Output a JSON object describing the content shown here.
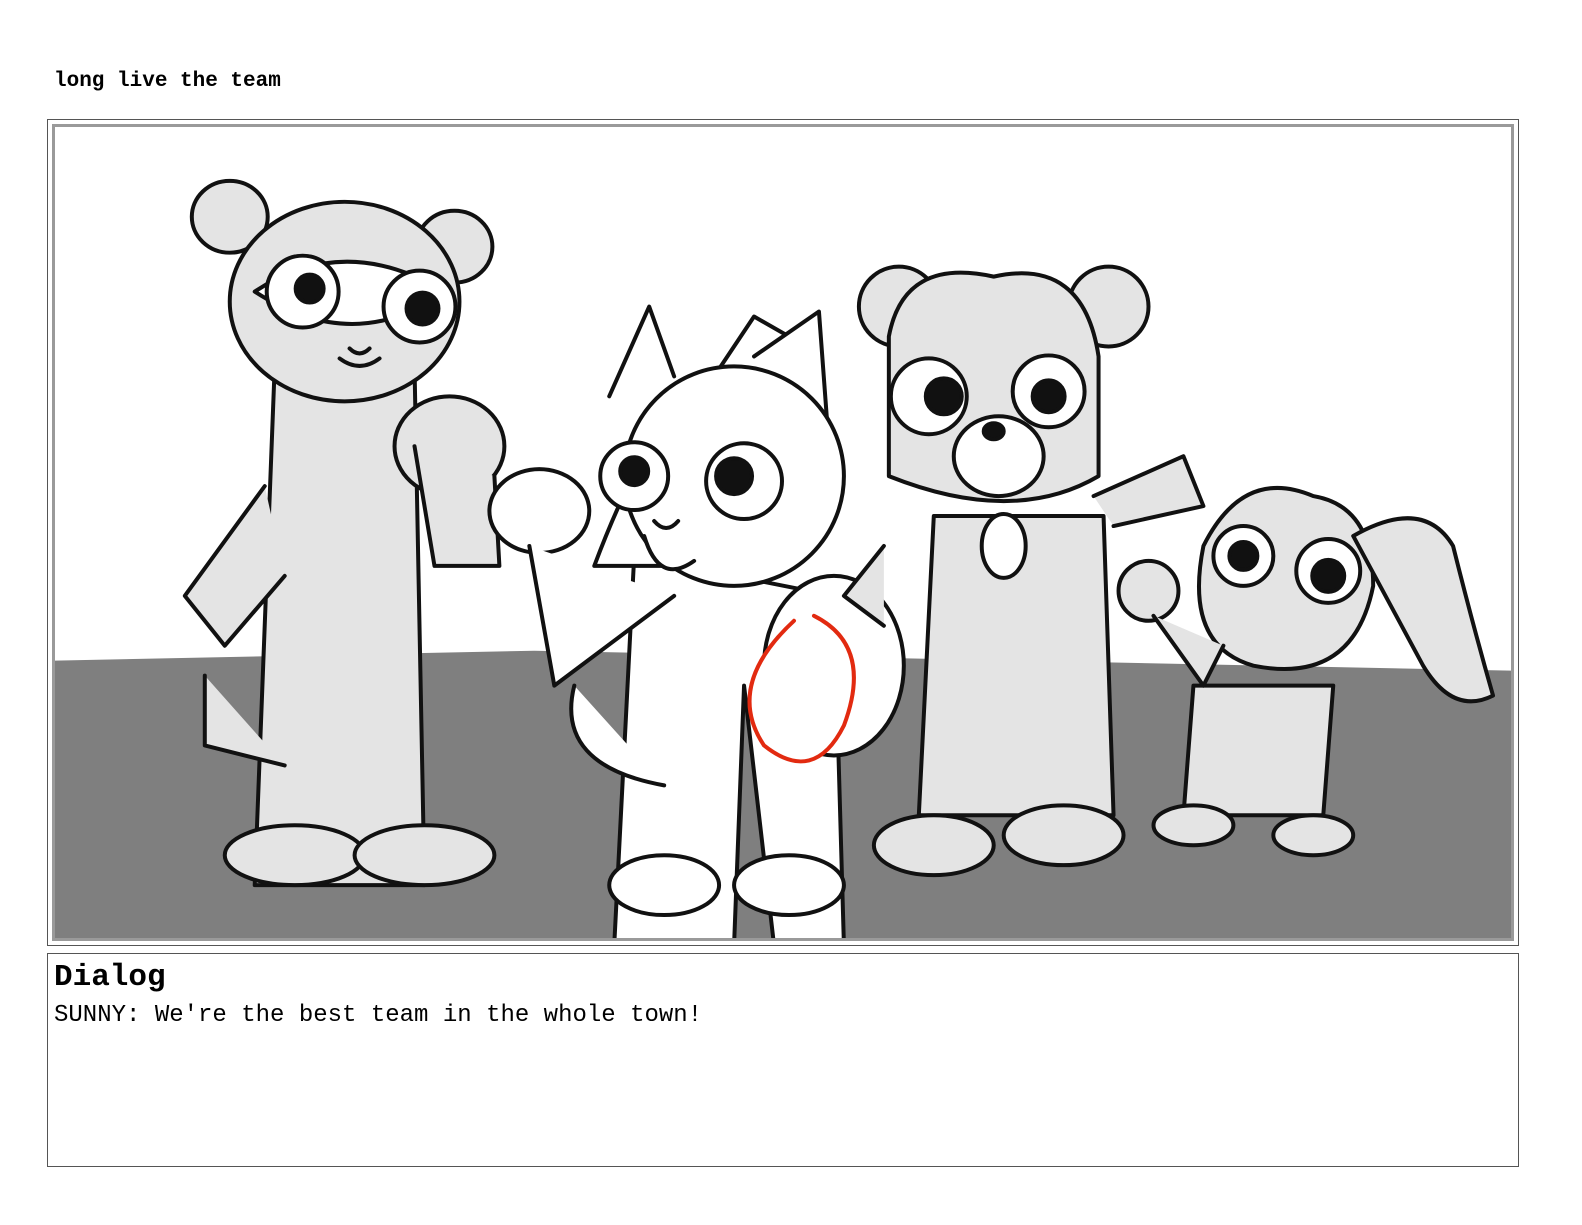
{
  "page": {
    "title": "long live the team"
  },
  "panel": {
    "illustration": "storyboard-sketch",
    "colors": {
      "background": "#ffffff",
      "ground": "#7f7f7f",
      "character_fill": "#e4e4e4",
      "line": "#111111",
      "accent": "#e22a10"
    }
  },
  "dialog": {
    "heading": "Dialog",
    "text": "SUNNY: We're the best team in the whole town!"
  }
}
